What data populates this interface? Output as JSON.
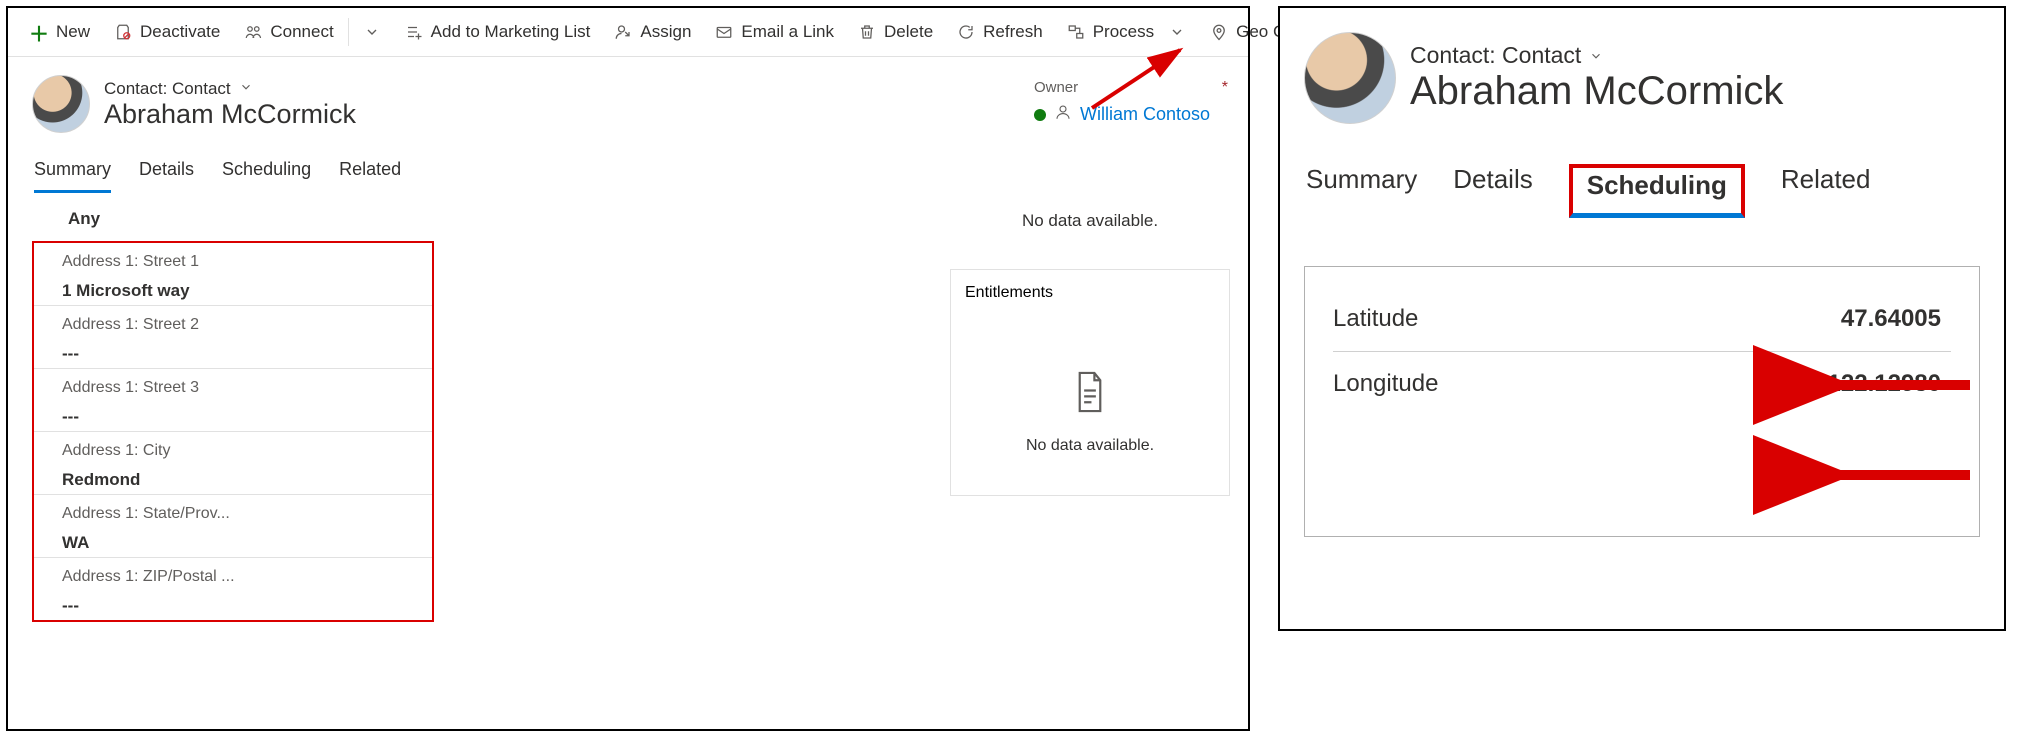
{
  "left": {
    "commands": {
      "new": "New",
      "deactivate": "Deactivate",
      "connect": "Connect",
      "add_marketing": "Add to Marketing List",
      "assign": "Assign",
      "email_link": "Email a Link",
      "delete": "Delete",
      "refresh": "Refresh",
      "process": "Process",
      "geocode": "Geo Code"
    },
    "entity": {
      "type": "Contact: Contact",
      "name": "Abraham McCormick"
    },
    "owner": {
      "label": "Owner",
      "value": "William Contoso"
    },
    "tabs": [
      "Summary",
      "Details",
      "Scheduling",
      "Related"
    ],
    "active_tab": 0,
    "section_title": "Any",
    "fields": [
      {
        "label": "Address 1: Street 1",
        "value": "1 Microsoft way"
      },
      {
        "label": "Address 1: Street 2",
        "value": "---"
      },
      {
        "label": "Address 1: Street 3",
        "value": "---"
      },
      {
        "label": "Address 1: City",
        "value": "Redmond"
      },
      {
        "label": "Address 1: State/Prov...",
        "value": "WA"
      },
      {
        "label": "Address 1: ZIP/Postal ...",
        "value": "---"
      }
    ],
    "side": {
      "no_data_top": "No data available.",
      "entitlements": "Entitlements",
      "no_data_bottom": "No data available."
    }
  },
  "right": {
    "entity": {
      "type": "Contact: Contact",
      "name": "Abraham McCormick"
    },
    "tabs": [
      "Summary",
      "Details",
      "Scheduling",
      "Related"
    ],
    "active_tab": 2,
    "coords": {
      "lat_label": "Latitude",
      "lat_value": "47.64005",
      "lon_label": "Longitude",
      "lon_value": "-122.12980"
    }
  }
}
